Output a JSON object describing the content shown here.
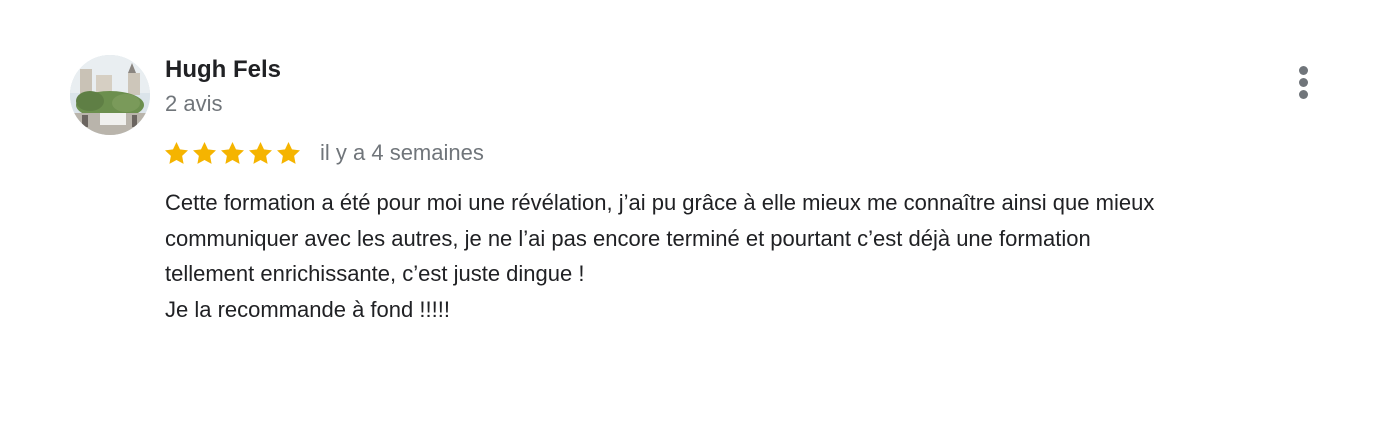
{
  "review": {
    "reviewer": {
      "name": "Hugh Fels",
      "review_count": "2 avis",
      "avatar_icon": "avatar-photo"
    },
    "more_icon": "more-vert-icon",
    "rating": {
      "stars": 5,
      "max_stars": 5,
      "star_color": "#f5b400",
      "date": "il y a 4 semaines"
    },
    "text_lines": [
      "Cette formation a été pour moi une révélation, j’ai pu grâce à elle mieux me connaître ainsi que mieux",
      "communiquer avec les autres, je ne l’ai pas encore terminé et pourtant c’est déjà une formation",
      "tellement enrichissante, c’est juste dingue !",
      "Je la recommande à fond !!!!!"
    ]
  }
}
